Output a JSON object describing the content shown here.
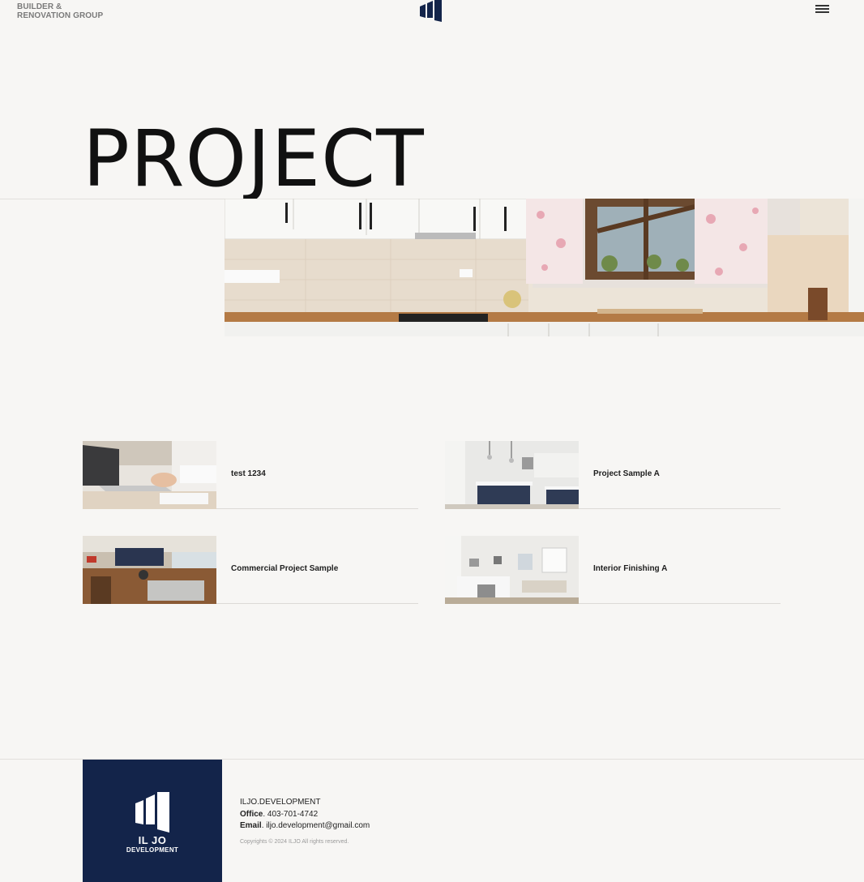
{
  "header": {
    "brand_line1": "BUILDER &",
    "brand_line2": "RENOVATION GROUP",
    "logo_icon": "building-logo-icon",
    "menu_icon": "hamburger-menu-icon"
  },
  "main": {
    "title": "PROJECT",
    "projects": [
      {
        "label": "test 1234"
      },
      {
        "label": "Project Sample A"
      },
      {
        "label": "Commercial Project Sample"
      },
      {
        "label": "Interior Finishing A"
      }
    ]
  },
  "footer": {
    "logo_line1": "IL JO",
    "logo_line2": "DEVELOPMENT",
    "company": "ILJO.DEVELOPMENT",
    "office_label": "Office",
    "office_value": ". 403-701-4742",
    "email_label": "Email",
    "email_value": ". iljo.development@gmail.com",
    "copyright": "Copyrights © 2024 ILJO All rights reserved."
  },
  "colors": {
    "background": "#f7f6f4",
    "brand_navy": "#13244a"
  }
}
